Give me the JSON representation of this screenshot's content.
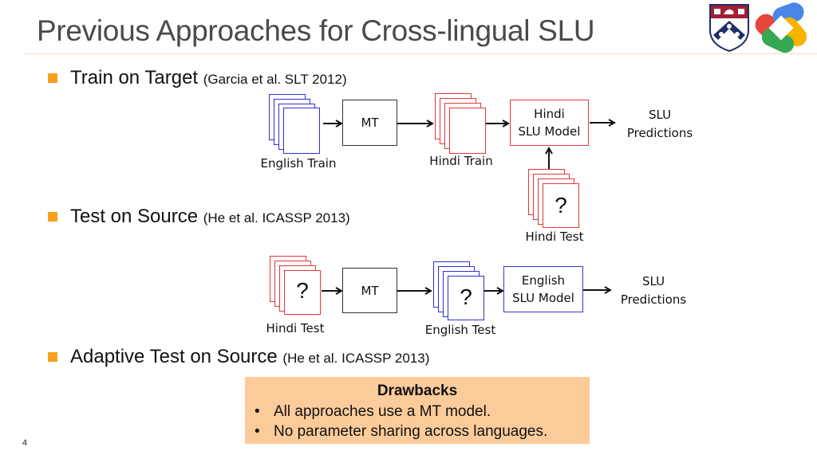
{
  "slide": {
    "title": "Previous Approaches for Cross-lingual SLU",
    "page_number": "4",
    "accent_color": "#f7a11a"
  },
  "logos": [
    {
      "name": "penn-shield-logo"
    },
    {
      "name": "google-knot-logo"
    }
  ],
  "bullets": [
    {
      "label": "Train on Target",
      "citation": "(Garcia et al. SLT 2012)"
    },
    {
      "label": "Test on Source",
      "citation": "(He et al. ICASSP 2013)"
    },
    {
      "label": "Adaptive Test on Source",
      "citation": "(He et al. ICASSP 2013)"
    }
  ],
  "diagram1": {
    "source_label": "English Train",
    "mt_label": "MT",
    "target_label": "Hindi Train",
    "model_line1": "Hindi",
    "model_line2": "SLU Model",
    "output_line1": "SLU",
    "output_line2": "Predictions",
    "test_label": "Hindi Test",
    "test_mark": "?"
  },
  "diagram2": {
    "source_label": "Hindi Test",
    "source_mark": "?",
    "mt_label": "MT",
    "target_label": "English Test",
    "target_mark": "?",
    "model_line1": "English",
    "model_line2": "SLU Model",
    "output_line1": "SLU",
    "output_line2": "Predictions"
  },
  "drawbacks": {
    "heading": "Drawbacks",
    "bullet_char": "•",
    "items": [
      "All approaches use a MT model.",
      "No parameter sharing across languages."
    ]
  }
}
